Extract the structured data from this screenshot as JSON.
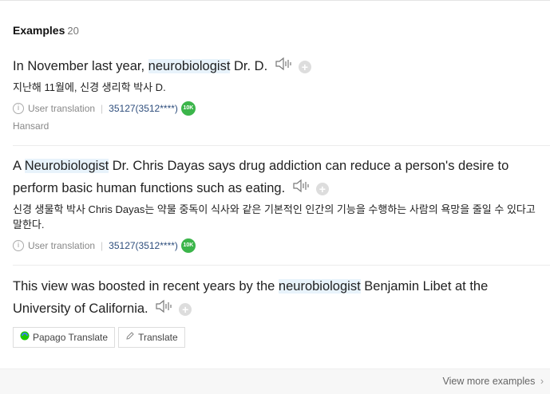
{
  "header": {
    "title": "Examples",
    "count": "20"
  },
  "examples": [
    {
      "en_before": "In November last year, ",
      "en_hl": "neurobiologist",
      "en_after": " Dr. D.",
      "ko": "지난해 11월에, 신경 생리학 박사 D.",
      "meta_label": "User translation",
      "user_id": "35127(3512****)",
      "badge": "10K",
      "source": "Hansard"
    },
    {
      "en_before": "A ",
      "en_hl": "Neurobiologist",
      "en_after": " Dr. Chris Dayas says drug addiction can reduce a person's desire to perform basic human functions such as eating.",
      "ko": "신경 생물학 박사 Chris Dayas는 약물 중독이 식사와 같은 기본적인 인간의 기능을 수행하는 사람의 욕망을 줄일 수 있다고 말한다.",
      "meta_label": "User translation",
      "user_id": "35127(3512****)",
      "badge": "10K"
    },
    {
      "en_before": "This view was boosted in recent years by the ",
      "en_hl": "neurobiologist",
      "en_after": " Benjamin Libet at the University of California.",
      "papago_label": "Papago Translate",
      "translate_label": "Translate"
    }
  ],
  "footer": {
    "more_label": "View more examples"
  }
}
